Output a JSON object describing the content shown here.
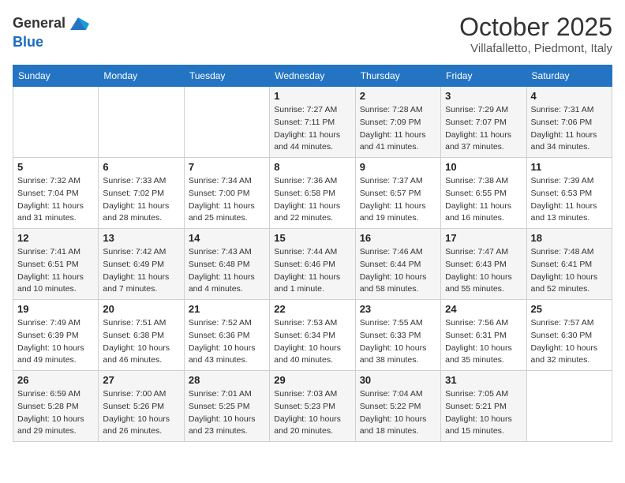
{
  "header": {
    "logo_line1": "General",
    "logo_line2": "Blue",
    "month": "October 2025",
    "location": "Villafalletto, Piedmont, Italy"
  },
  "days_of_week": [
    "Sunday",
    "Monday",
    "Tuesday",
    "Wednesday",
    "Thursday",
    "Friday",
    "Saturday"
  ],
  "weeks": [
    [
      {
        "day": "",
        "sunrise": "",
        "sunset": "",
        "daylight": ""
      },
      {
        "day": "",
        "sunrise": "",
        "sunset": "",
        "daylight": ""
      },
      {
        "day": "",
        "sunrise": "",
        "sunset": "",
        "daylight": ""
      },
      {
        "day": "1",
        "sunrise": "Sunrise: 7:27 AM",
        "sunset": "Sunset: 7:11 PM",
        "daylight": "Daylight: 11 hours and 44 minutes."
      },
      {
        "day": "2",
        "sunrise": "Sunrise: 7:28 AM",
        "sunset": "Sunset: 7:09 PM",
        "daylight": "Daylight: 11 hours and 41 minutes."
      },
      {
        "day": "3",
        "sunrise": "Sunrise: 7:29 AM",
        "sunset": "Sunset: 7:07 PM",
        "daylight": "Daylight: 11 hours and 37 minutes."
      },
      {
        "day": "4",
        "sunrise": "Sunrise: 7:31 AM",
        "sunset": "Sunset: 7:06 PM",
        "daylight": "Daylight: 11 hours and 34 minutes."
      }
    ],
    [
      {
        "day": "5",
        "sunrise": "Sunrise: 7:32 AM",
        "sunset": "Sunset: 7:04 PM",
        "daylight": "Daylight: 11 hours and 31 minutes."
      },
      {
        "day": "6",
        "sunrise": "Sunrise: 7:33 AM",
        "sunset": "Sunset: 7:02 PM",
        "daylight": "Daylight: 11 hours and 28 minutes."
      },
      {
        "day": "7",
        "sunrise": "Sunrise: 7:34 AM",
        "sunset": "Sunset: 7:00 PM",
        "daylight": "Daylight: 11 hours and 25 minutes."
      },
      {
        "day": "8",
        "sunrise": "Sunrise: 7:36 AM",
        "sunset": "Sunset: 6:58 PM",
        "daylight": "Daylight: 11 hours and 22 minutes."
      },
      {
        "day": "9",
        "sunrise": "Sunrise: 7:37 AM",
        "sunset": "Sunset: 6:57 PM",
        "daylight": "Daylight: 11 hours and 19 minutes."
      },
      {
        "day": "10",
        "sunrise": "Sunrise: 7:38 AM",
        "sunset": "Sunset: 6:55 PM",
        "daylight": "Daylight: 11 hours and 16 minutes."
      },
      {
        "day": "11",
        "sunrise": "Sunrise: 7:39 AM",
        "sunset": "Sunset: 6:53 PM",
        "daylight": "Daylight: 11 hours and 13 minutes."
      }
    ],
    [
      {
        "day": "12",
        "sunrise": "Sunrise: 7:41 AM",
        "sunset": "Sunset: 6:51 PM",
        "daylight": "Daylight: 11 hours and 10 minutes."
      },
      {
        "day": "13",
        "sunrise": "Sunrise: 7:42 AM",
        "sunset": "Sunset: 6:49 PM",
        "daylight": "Daylight: 11 hours and 7 minutes."
      },
      {
        "day": "14",
        "sunrise": "Sunrise: 7:43 AM",
        "sunset": "Sunset: 6:48 PM",
        "daylight": "Daylight: 11 hours and 4 minutes."
      },
      {
        "day": "15",
        "sunrise": "Sunrise: 7:44 AM",
        "sunset": "Sunset: 6:46 PM",
        "daylight": "Daylight: 11 hours and 1 minute."
      },
      {
        "day": "16",
        "sunrise": "Sunrise: 7:46 AM",
        "sunset": "Sunset: 6:44 PM",
        "daylight": "Daylight: 10 hours and 58 minutes."
      },
      {
        "day": "17",
        "sunrise": "Sunrise: 7:47 AM",
        "sunset": "Sunset: 6:43 PM",
        "daylight": "Daylight: 10 hours and 55 minutes."
      },
      {
        "day": "18",
        "sunrise": "Sunrise: 7:48 AM",
        "sunset": "Sunset: 6:41 PM",
        "daylight": "Daylight: 10 hours and 52 minutes."
      }
    ],
    [
      {
        "day": "19",
        "sunrise": "Sunrise: 7:49 AM",
        "sunset": "Sunset: 6:39 PM",
        "daylight": "Daylight: 10 hours and 49 minutes."
      },
      {
        "day": "20",
        "sunrise": "Sunrise: 7:51 AM",
        "sunset": "Sunset: 6:38 PM",
        "daylight": "Daylight: 10 hours and 46 minutes."
      },
      {
        "day": "21",
        "sunrise": "Sunrise: 7:52 AM",
        "sunset": "Sunset: 6:36 PM",
        "daylight": "Daylight: 10 hours and 43 minutes."
      },
      {
        "day": "22",
        "sunrise": "Sunrise: 7:53 AM",
        "sunset": "Sunset: 6:34 PM",
        "daylight": "Daylight: 10 hours and 40 minutes."
      },
      {
        "day": "23",
        "sunrise": "Sunrise: 7:55 AM",
        "sunset": "Sunset: 6:33 PM",
        "daylight": "Daylight: 10 hours and 38 minutes."
      },
      {
        "day": "24",
        "sunrise": "Sunrise: 7:56 AM",
        "sunset": "Sunset: 6:31 PM",
        "daylight": "Daylight: 10 hours and 35 minutes."
      },
      {
        "day": "25",
        "sunrise": "Sunrise: 7:57 AM",
        "sunset": "Sunset: 6:30 PM",
        "daylight": "Daylight: 10 hours and 32 minutes."
      }
    ],
    [
      {
        "day": "26",
        "sunrise": "Sunrise: 6:59 AM",
        "sunset": "Sunset: 5:28 PM",
        "daylight": "Daylight: 10 hours and 29 minutes."
      },
      {
        "day": "27",
        "sunrise": "Sunrise: 7:00 AM",
        "sunset": "Sunset: 5:26 PM",
        "daylight": "Daylight: 10 hours and 26 minutes."
      },
      {
        "day": "28",
        "sunrise": "Sunrise: 7:01 AM",
        "sunset": "Sunset: 5:25 PM",
        "daylight": "Daylight: 10 hours and 23 minutes."
      },
      {
        "day": "29",
        "sunrise": "Sunrise: 7:03 AM",
        "sunset": "Sunset: 5:23 PM",
        "daylight": "Daylight: 10 hours and 20 minutes."
      },
      {
        "day": "30",
        "sunrise": "Sunrise: 7:04 AM",
        "sunset": "Sunset: 5:22 PM",
        "daylight": "Daylight: 10 hours and 18 minutes."
      },
      {
        "day": "31",
        "sunrise": "Sunrise: 7:05 AM",
        "sunset": "Sunset: 5:21 PM",
        "daylight": "Daylight: 10 hours and 15 minutes."
      },
      {
        "day": "",
        "sunrise": "",
        "sunset": "",
        "daylight": ""
      }
    ]
  ]
}
